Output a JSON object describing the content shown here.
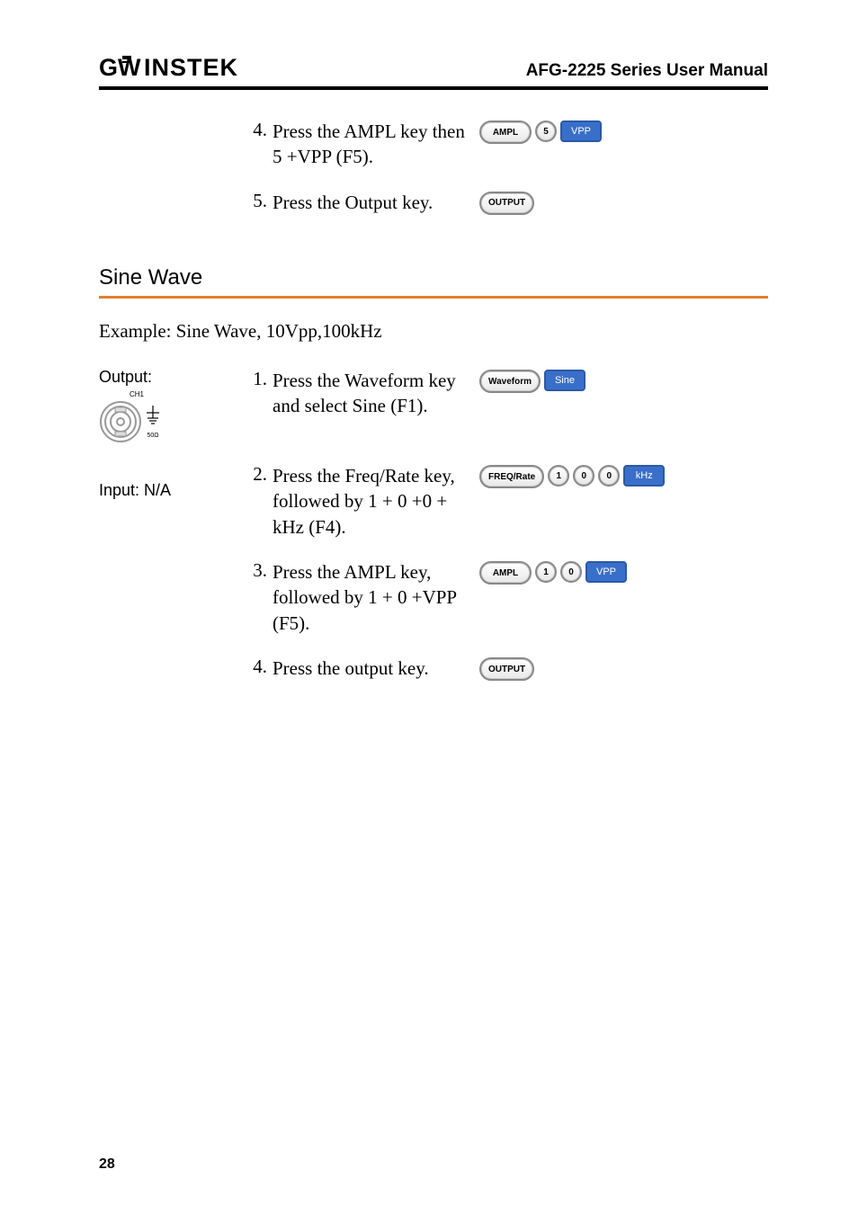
{
  "header": {
    "logo": "GWINSTEK",
    "title": "AFG-2225 Series User Manual"
  },
  "top_steps": [
    {
      "num": "4.",
      "text": "Press the AMPL key then 5 +VPP (F5).",
      "keys": [
        {
          "type": "hw",
          "label": "AMPL"
        },
        {
          "type": "num",
          "label": "5"
        },
        {
          "type": "soft",
          "label": "VPP"
        }
      ]
    },
    {
      "num": "5.",
      "text": "Press the Output key.",
      "keys": [
        {
          "type": "hw",
          "label": "OUTPUT"
        }
      ]
    }
  ],
  "section": {
    "heading": "Sine Wave",
    "example": "Example: Sine Wave, 10Vpp,100kHz"
  },
  "left": {
    "output_label": "Output:",
    "ch_label": "CH1",
    "ohm_label": "50Ω",
    "input_label": "Input: N/A"
  },
  "sine_steps": [
    {
      "num": "1.",
      "text": "Press the Waveform key and select Sine (F1).",
      "keys": [
        {
          "type": "hw",
          "label": "Waveform"
        },
        {
          "type": "soft",
          "label": "Sine"
        }
      ]
    },
    {
      "num": "2.",
      "text": "Press the Freq/Rate key, followed by 1 + 0 +0 + kHz (F4).",
      "keys": [
        {
          "type": "hw",
          "label": "FREQ/Rate"
        },
        {
          "type": "num",
          "label": "1"
        },
        {
          "type": "num",
          "label": "0"
        },
        {
          "type": "num",
          "label": "0"
        },
        {
          "type": "soft",
          "label": "kHz"
        }
      ]
    },
    {
      "num": "3.",
      "text": "Press the AMPL key, followed by 1 + 0 +VPP (F5).",
      "keys": [
        {
          "type": "hw",
          "label": "AMPL"
        },
        {
          "type": "num",
          "label": "1"
        },
        {
          "type": "num",
          "label": "0"
        },
        {
          "type": "soft",
          "label": "VPP"
        }
      ]
    },
    {
      "num": "4.",
      "text": "Press the output key.",
      "keys": [
        {
          "type": "hw",
          "label": "OUTPUT"
        }
      ]
    }
  ],
  "page_number": "28"
}
